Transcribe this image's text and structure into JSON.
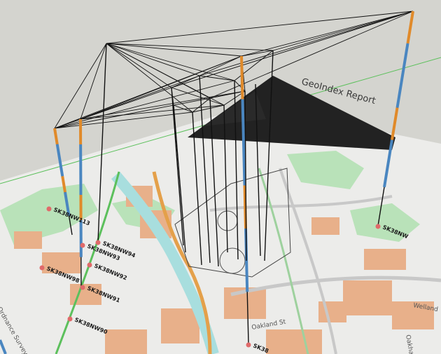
{
  "report_label": "GeoIndex Report",
  "copyright_label": "Ordnance Survey",
  "street_labels": [
    "Welland",
    "Oakham",
    "Oakland St"
  ],
  "boreholes": [
    {
      "id": "SK38NW90",
      "label": "SK38NW90"
    },
    {
      "id": "SK38NW91",
      "label": "SK38NW91"
    },
    {
      "id": "SK38NW92",
      "label": "SK38NW92"
    },
    {
      "id": "SK38NW93",
      "label": "SK38NW93"
    },
    {
      "id": "SK38NW94",
      "label": "SK38NW94"
    },
    {
      "id": "SK38NW113",
      "label": "SK38NW113"
    },
    {
      "id": "SK38NW98",
      "label": "SK38NW98"
    },
    {
      "id": "SK38NW_east",
      "label": "SK38NW"
    },
    {
      "id": "SK38_front",
      "label": "SK38"
    }
  ],
  "colors": {
    "background": "#d4d4cf",
    "map_paper": "#ececea",
    "building": "#e8b08a",
    "green": "#a8d8a8",
    "water": "#a8dede",
    "road_major": "#e4a04a",
    "road_minor": "#c8c8c8",
    "log_blue": "#4a86c0",
    "log_orange": "#e08a2a",
    "wire": "#111111",
    "surface_fill": "#222222",
    "marker": "#e06a6a"
  }
}
